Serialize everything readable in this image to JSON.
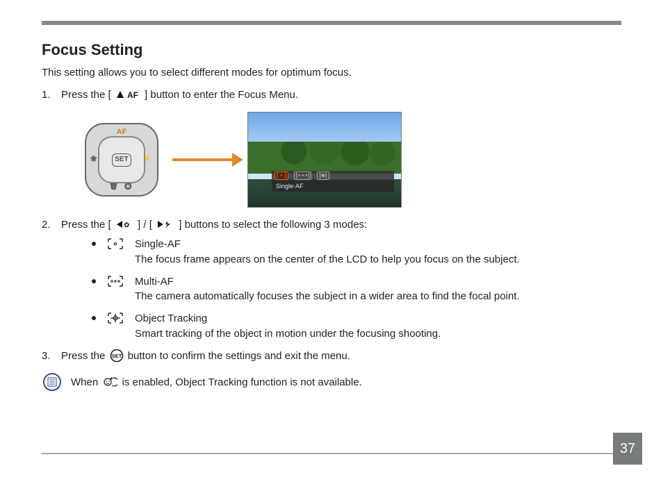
{
  "page_number": "37",
  "heading": "Focus Setting",
  "intro": "This setting allows you to select different modes for optimum focus.",
  "steps": {
    "s1": {
      "num": "1.",
      "pre": "Press the [ ",
      "post": " ] button to enter the Focus Menu."
    },
    "s2": {
      "num": "2.",
      "pre": "Press the [ ",
      "mid": " ] / [ ",
      "post": " ] buttons to select the following 3 modes:"
    },
    "s3": {
      "num": "3.",
      "pre": "Press the ",
      "post": " button to confirm the settings and exit the menu."
    }
  },
  "control_pad": {
    "af": "AF",
    "set": "SET",
    "left": "❀",
    "right": "⚡",
    "bottom": "🗑 ⏱"
  },
  "screen": {
    "label": "Single-AF",
    "options": [
      "[ ∘ ]",
      "[∘∘∘]",
      "[⊕]"
    ]
  },
  "af_label": "AF",
  "set_label": "SET",
  "modes": {
    "single": {
      "title": "Single-AF",
      "desc": "The focus frame appears on the center of the LCD to help you focus on the subject."
    },
    "multi": {
      "title": "Multi-AF",
      "desc": "The camera automatically focuses the subject in a wider area to find the focal point."
    },
    "tracking": {
      "title": "Object Tracking",
      "desc": "Smart tracking of the object in motion under the focusing shooting."
    }
  },
  "note": {
    "pre": "When ",
    "post": " is enabled, Object Tracking function is not available."
  }
}
